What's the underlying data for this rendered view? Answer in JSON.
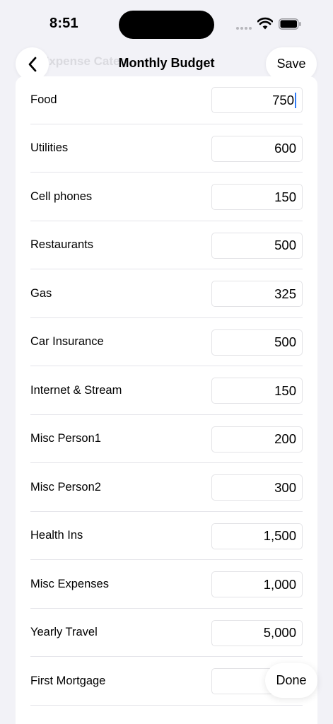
{
  "status_bar": {
    "time": "8:51",
    "icons": [
      "cellular-signal-icon",
      "wifi-icon",
      "battery-icon"
    ]
  },
  "nav": {
    "back_icon": "chevron-left-icon",
    "background_title": "Expense Categ",
    "title": "Monthly Budget",
    "save_label": "Save"
  },
  "rows": [
    {
      "label": "Food",
      "value": "750",
      "focused": true
    },
    {
      "label": "Utilities",
      "value": "600"
    },
    {
      "label": "Cell phones",
      "value": "150"
    },
    {
      "label": "Restaurants",
      "value": "500"
    },
    {
      "label": "Gas",
      "value": "325"
    },
    {
      "label": "Car Insurance",
      "value": "500"
    },
    {
      "label": "Internet & Stream",
      "value": "150"
    },
    {
      "label": "Misc Person1",
      "value": "200"
    },
    {
      "label": "Misc Person2",
      "value": "300"
    },
    {
      "label": "Health Ins",
      "value": "1,500"
    },
    {
      "label": "Misc Expenses",
      "value": "1,000"
    },
    {
      "label": "Yearly Travel",
      "value": "5,000"
    },
    {
      "label": "First Mortgage",
      "value": ""
    }
  ],
  "keyboard_toolbar": {
    "done_label": "Done"
  },
  "colors": {
    "background": "#f2f2f7",
    "card": "#ffffff",
    "caret": "#2f7bf6",
    "divider": "#e5e5ea"
  }
}
